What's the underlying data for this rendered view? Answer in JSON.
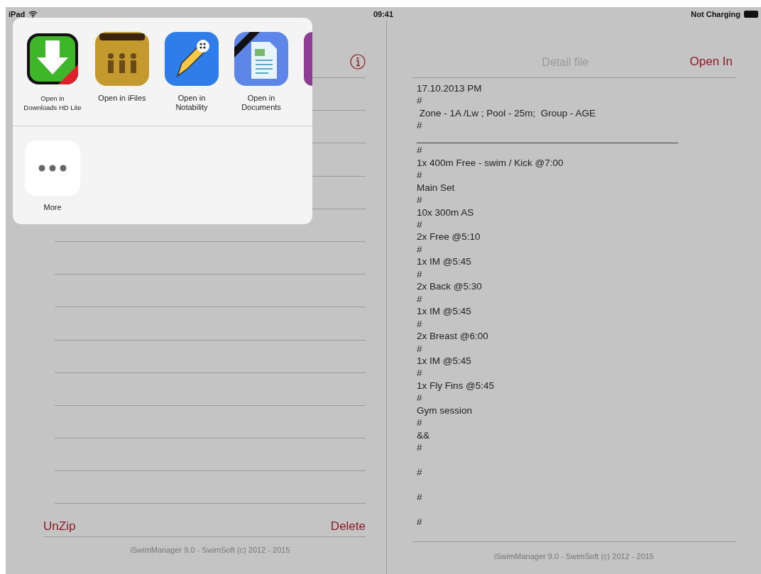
{
  "status_bar": {
    "device": "iPad",
    "time": "09:41",
    "battery_text": "Not Charging"
  },
  "file_list": {
    "buttons": [
      {
        "label": "UnZip"
      },
      {
        "label": "Delete"
      }
    ],
    "footer": "iSwimManager 9.0 - SwimSoft (c) 2012 - 2015"
  },
  "share_sheet": {
    "apps": [
      {
        "kind": "download",
        "label": "Open in\nDownloads HD Lite"
      },
      {
        "kind": "ifiles",
        "label": "Open in iFiles"
      },
      {
        "kind": "notability",
        "label": "Open in\nNotability"
      },
      {
        "kind": "documents",
        "label": "Open in\nDocuments"
      },
      {
        "kind": "partial"
      }
    ],
    "more": {
      "label": "More"
    }
  },
  "detail": {
    "title": "Detail file",
    "action": "Open In",
    "content": "17.10.2013 PM\n#\n Zone - 1A /Lw ; Pool - 25m;  Group - AGE\n#\n_________________________________________________\n#\n1x 400m Free - swim / Kick @7:00\n#\nMain Set\n#\n10x 300m AS\n#\n2x Free @5:10\n#\n1x IM @5:45\n#\n2x Back @5:30\n#\n1x IM @5:45\n#\n2x Breast @6:00\n#\n1x IM @5:45\n#\n1x Fly Fins @5:45\n#\nGym session\n#\n&&\n#\n\n#\n\n#\n\n#",
    "footer": "iSwimManager 9.0 - SwimSoft (c) 2012 - 2015"
  }
}
